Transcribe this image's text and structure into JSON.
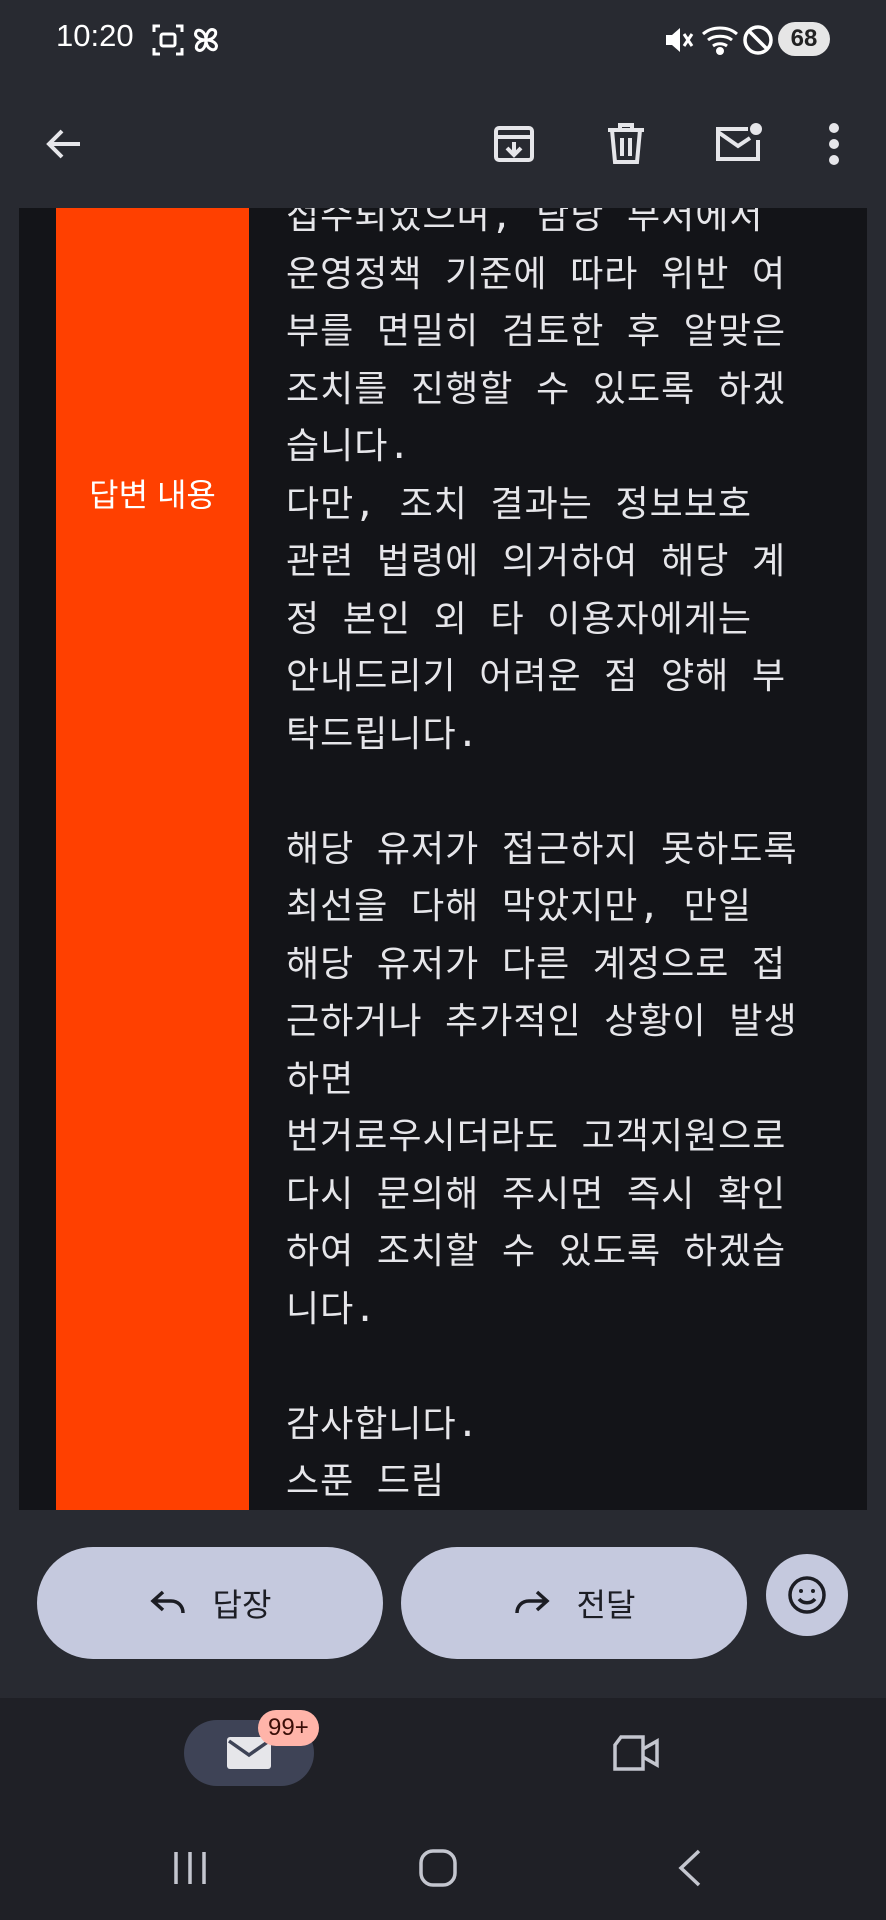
{
  "status_bar": {
    "time": "10:20",
    "battery": "68",
    "icons": [
      "screenshot-icon",
      "pinwheel-icon",
      "mute-icon",
      "wifi-icon",
      "do-not-disturb-icon"
    ]
  },
  "app_bar": {
    "icons": [
      "back-arrow-icon",
      "archive-icon",
      "trash-icon",
      "mark-unread-icon",
      "more-vert-icon"
    ]
  },
  "message": {
    "label": "답변 내용",
    "body": "접수되었으며, 담당 부서에서\n운영정책 기준에 따라 위반 여\n부를 면밀히 검토한 후 알맞은\n조치를 진행할 수 있도록 하겠\n습니다.\n다만, 조치 결과는 정보보호\n관련 법령에 의거하여 해당 계\n정 본인 외 타 이용자에게는\n안내드리기 어려운 점 양해 부\n탁드립니다.\n\n해당 유저가 접근하지 못하도록\n최선을 다해 막았지만, 만일\n해당 유저가 다른 계정으로 접\n근하거나 추가적인 상황이 발생\n하면\n번거로우시더라도 고객지원으로\n다시 문의해 주시면 즉시 확인\n하여 조치할 수 있도록 하겠습\n니다.\n\n감사합니다.\n스푼 드림"
  },
  "actions": {
    "reply_label": "답장",
    "forward_label": "전달"
  },
  "bottom_nav": {
    "mail_badge": "99+"
  },
  "colors": {
    "accent_label_bg": "#ff4000",
    "pill_bg": "#c5c9de",
    "badge_bg": "#ffb4a9",
    "background": "#282a31",
    "card_bg": "#131418"
  }
}
